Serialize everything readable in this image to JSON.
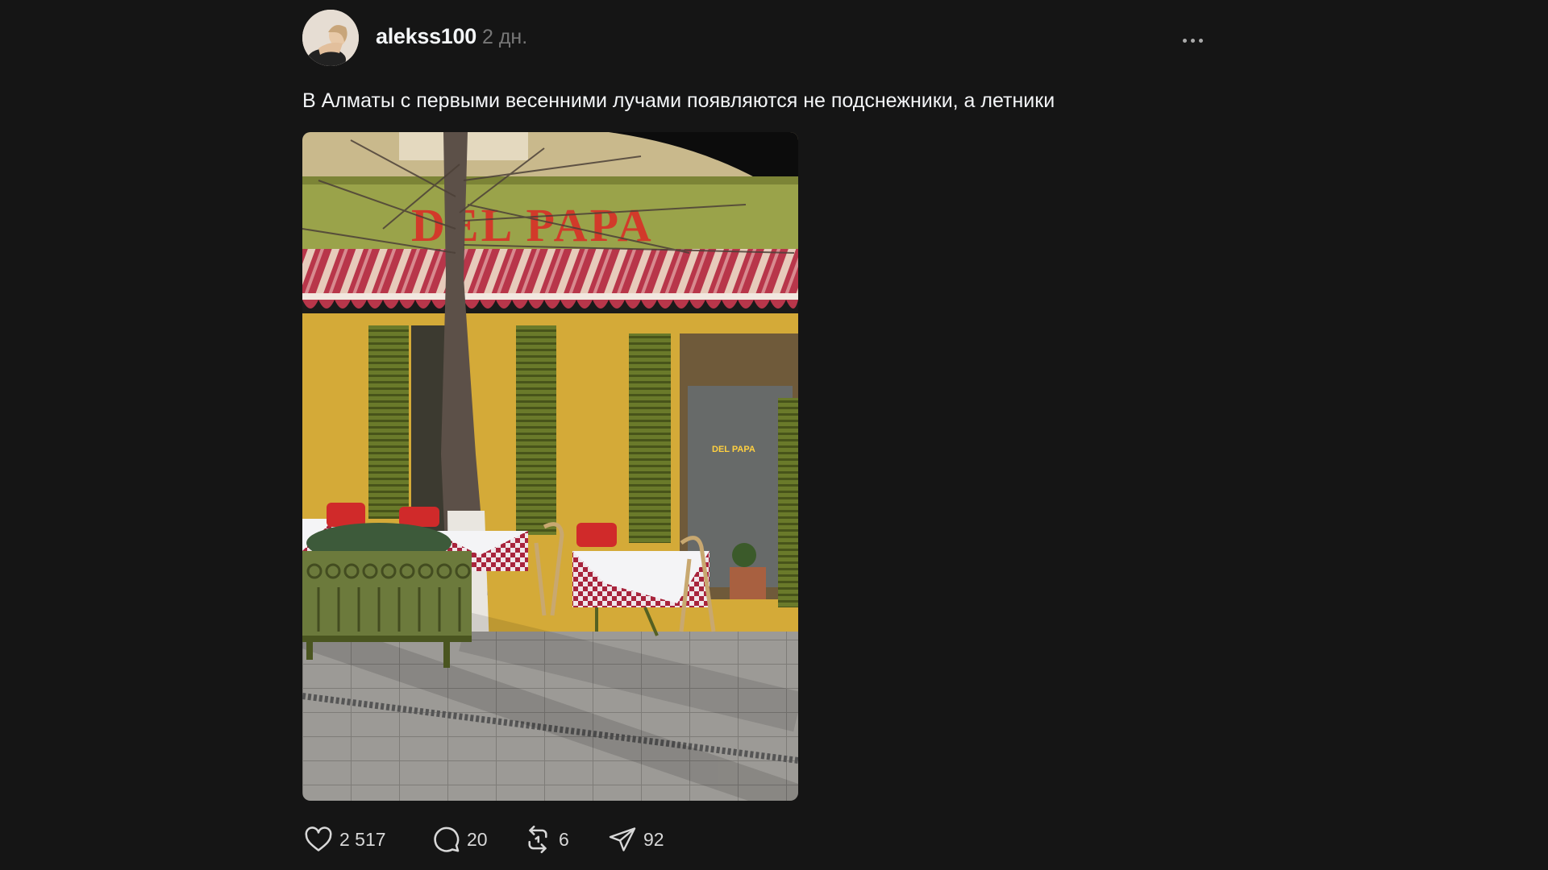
{
  "post": {
    "author": {
      "username": "alekss100",
      "timestamp": "2 дн."
    },
    "text": "В Алматы с первыми весенними лучами появляются не подснежники, а летники",
    "photo": {
      "sign_main": "DEL PAPA",
      "sign_window": "DEL PAPA"
    },
    "more_icon": "more-horizontal-icon",
    "actions": {
      "likes": {
        "icon": "heart-icon",
        "count": "2 517"
      },
      "comments": {
        "icon": "comment-icon",
        "count": "20"
      },
      "reposts": {
        "icon": "repost-icon",
        "count": "6"
      },
      "shares": {
        "icon": "send-icon",
        "count": "92"
      }
    }
  },
  "colors": {
    "background": "#151515",
    "text_primary": "#f3f5f7",
    "text_secondary": "#777777",
    "icon": "#d8d8d8"
  }
}
